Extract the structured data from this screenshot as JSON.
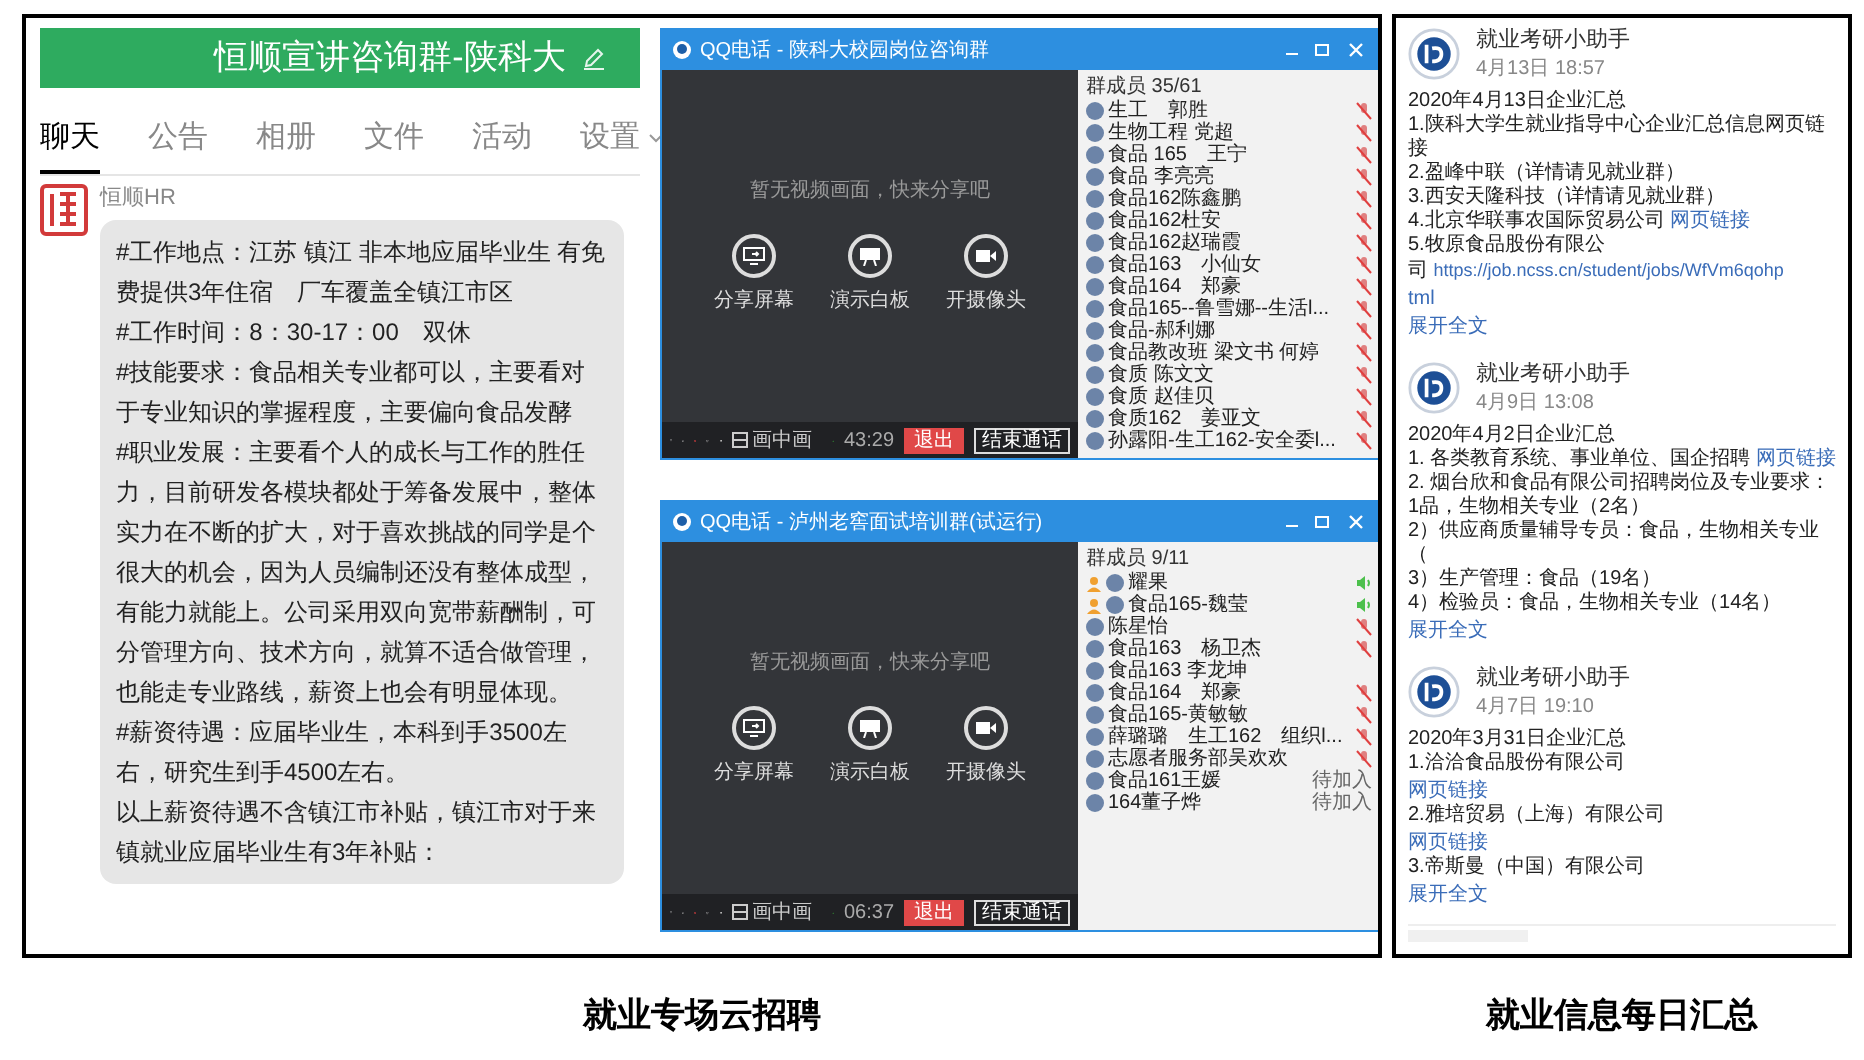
{
  "group_chat": {
    "title": "恒顺宣讲咨询群-陕科大",
    "tabs": [
      {
        "label": "聊天",
        "selected": true
      },
      {
        "label": "公告",
        "selected": false
      },
      {
        "label": "相册",
        "selected": false
      },
      {
        "label": "文件",
        "selected": false
      },
      {
        "label": "活动",
        "selected": false
      },
      {
        "label": "设置",
        "selected": false
      }
    ],
    "message": {
      "sender": "恒顺HR",
      "paragraphs": [
        "#工作地点：江苏 镇江 非本地应届毕业生 有免费提供3年住宿　厂车覆盖全镇江市区",
        "#工作时间：8：30-17：00　双休",
        "#技能要求：食品相关专业都可以，主要看对于专业知识的掌握程度，主要偏向食品发酵",
        "#职业发展：主要看个人的成长与工作的胜任力，目前研发各模块都处于筹备发展中，整体实力在不断的扩大，对于喜欢挑战的同学是个很大的机会，因为人员编制还没有整体成型，有能力就能上。公司采用双向宽带薪酬制，可分管理方向、技术方向，就算不适合做管理，也能走专业路线，薪资上也会有明显体现。",
        "#薪资待遇：应届毕业生，本科到手3500左右，研究生到手4500左右。",
        "以上薪资待遇不含镇江市补贴，镇江市对于来镇就业应届毕业生有3年补贴："
      ]
    }
  },
  "calls": [
    {
      "title": "QQ电话 - 陕科大校园岗位咨询群",
      "prompt": "暂无视频画面，快来分享吧",
      "actions": [
        "分享屏幕",
        "演示白板",
        "开摄像头"
      ],
      "pip": "画中画",
      "timer": "43:29",
      "leave": "退出",
      "end": "结束通话",
      "members_header": "群成员 35/61",
      "members": [
        {
          "name": "生工　郭胜",
          "kind": "muted",
          "host": false
        },
        {
          "name": "生物工程 党超",
          "kind": "muted",
          "host": false
        },
        {
          "name": "食品 165　王宁",
          "kind": "muted",
          "host": false
        },
        {
          "name": "食品 李亮亮",
          "kind": "muted",
          "host": false
        },
        {
          "name": "食品162陈鑫鹏",
          "kind": "muted",
          "host": false
        },
        {
          "name": "食品162杜安",
          "kind": "muted",
          "host": false
        },
        {
          "name": "食品162赵瑞霞",
          "kind": "muted",
          "host": false
        },
        {
          "name": "食品163　小仙女",
          "kind": "muted",
          "host": false
        },
        {
          "name": "食品164　郑豪",
          "kind": "muted",
          "host": false
        },
        {
          "name": "食品165--鲁雪娜--生活l...",
          "kind": "muted",
          "host": false
        },
        {
          "name": "食品-郝利娜",
          "kind": "muted",
          "host": false
        },
        {
          "name": "食品教改班 梁文书 何婷",
          "kind": "muted",
          "host": false
        },
        {
          "name": "食质 陈文文",
          "kind": "muted",
          "host": false
        },
        {
          "name": "食质 赵佳贝",
          "kind": "muted",
          "host": false
        },
        {
          "name": "食质162　姜亚文",
          "kind": "muted",
          "host": false
        },
        {
          "name": "孙露阳-生工162-安全委l...",
          "kind": "muted",
          "host": false
        }
      ]
    },
    {
      "title": "QQ电话 - 泸州老窖面试培训群(试运行)",
      "prompt": "暂无视频画面，快来分享吧",
      "actions": [
        "分享屏幕",
        "演示白板",
        "开摄像头"
      ],
      "pip": "画中画",
      "timer": "06:37",
      "leave": "退出",
      "end": "结束通话",
      "members_header": "群成员 9/11",
      "members": [
        {
          "name": "耀果",
          "kind": "talking",
          "host": true
        },
        {
          "name": "食品165-魏莹",
          "kind": "talking",
          "host": true
        },
        {
          "name": "陈星怡",
          "kind": "muted",
          "host": false
        },
        {
          "name": "食品163　杨卫杰",
          "kind": "muted",
          "host": false
        },
        {
          "name": "食品163 李龙坤",
          "kind": "silent",
          "host": false
        },
        {
          "name": "食品164　郑豪",
          "kind": "muted",
          "host": false
        },
        {
          "name": "食品165-黄敏敏",
          "kind": "muted",
          "host": false
        },
        {
          "name": "薛璐璐　生工162　组织l...",
          "kind": "muted",
          "host": false
        },
        {
          "name": "志愿者服务部吴欢欢",
          "kind": "muted",
          "host": false
        },
        {
          "name": "食品161王媛",
          "kind": "pending",
          "host": false,
          "status": "待加入"
        },
        {
          "name": "164董子烨",
          "kind": "pending",
          "host": false,
          "status": "待加入"
        }
      ]
    }
  ],
  "feed": {
    "posts": [
      {
        "author": "就业考研小助手",
        "time": "4月13日 18:57",
        "expand": "展开全文",
        "lines": [
          {
            "text": "2020年4月13日企业汇总"
          },
          {
            "text": "1.陕科大学生就业指导中心企业汇总信息网页链接"
          },
          {
            "text": "2.盈峰中联（详情请见就业群）"
          },
          {
            "text": "3.西安天隆科技（详情请见就业群）"
          },
          {
            "text": "4.北京华联事农国际贸易公司",
            "link": "网页链接"
          },
          {
            "text": "5.牧原食品股份有限公"
          },
          {
            "text": "司",
            "link": "https://job.ncss.cn/student/jobs/WfVm6qohp"
          },
          {
            "link": "tml"
          }
        ]
      },
      {
        "author": "就业考研小助手",
        "time": "4月9日 13:08",
        "expand": "展开全文",
        "lines": [
          {
            "text": "2020年4月2日企业汇总"
          },
          {
            "text": "1. 各类教育系统、事业单位、国企招聘",
            "link": "网页链接"
          },
          {
            "text": "2. 烟台欣和食品有限公司招聘岗位及专业要求：1品，生物相关专业（2名）"
          },
          {
            "text": "2）供应商质量辅导专员：食品，生物相关专业（"
          },
          {
            "text": "3）生产管理：食品（19名）"
          },
          {
            "text": "4）检验员：食品，生物相关专业（14名）"
          }
        ]
      },
      {
        "author": "就业考研小助手",
        "time": "4月7日 19:10",
        "expand": "展开全文",
        "lines": [
          {
            "text": "2020年3月31日企业汇总"
          },
          {
            "text": "1.洽洽食品股份有限公司"
          },
          {
            "link": "网页链接"
          },
          {
            "text": "2.雅培贸易（上海）有限公司"
          },
          {
            "link": "网页链接"
          },
          {
            "text": "3.帝斯曼（中国）有限公司"
          }
        ]
      }
    ]
  },
  "captions": [
    "就业专场云招聘",
    "就业信息每日汇总"
  ]
}
